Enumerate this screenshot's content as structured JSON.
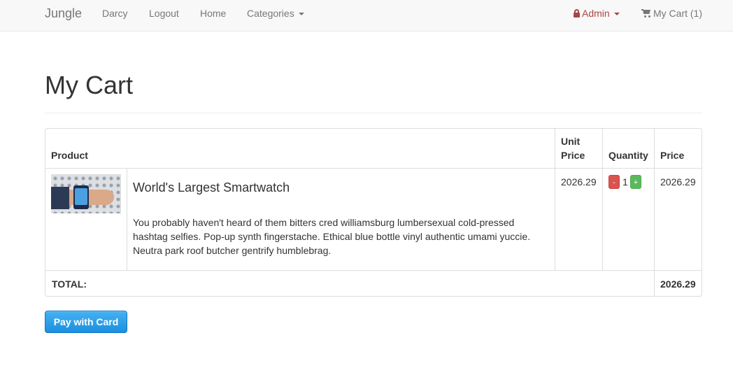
{
  "navbar": {
    "brand": "Jungle",
    "links": [
      "Darcy",
      "Logout",
      "Home"
    ],
    "categories_label": "Categories",
    "admin_label": "Admin",
    "cart_label": "My Cart (1)"
  },
  "page": {
    "title": "My Cart"
  },
  "table": {
    "headers": {
      "product": "Product",
      "unit_price": "Unit Price",
      "quantity": "Quantity",
      "price": "Price"
    },
    "rows": [
      {
        "name": "World's Largest Smartwatch",
        "description": "You probably haven't heard of them bitters cred williamsburg lumbersexual cold-pressed hashtag selfies. Pop-up synth fingerstache. Ethical blue bottle vinyl authentic umami yuccie. Neutra park roof butcher gentrify humblebrag.",
        "unit_price": "2026.29",
        "quantity": "1",
        "price": "2026.29",
        "minus_label": "-",
        "plus_label": "+"
      }
    ],
    "total_label": "TOTAL:",
    "total_value": "2026.29"
  },
  "pay_button": {
    "label": "Pay with Card"
  },
  "icons": {
    "admin": "lock-icon",
    "cart": "shopping-cart-icon"
  },
  "colors": {
    "admin": "#a94442",
    "pay_button": "#1b8fe0",
    "minus": "#d9534f",
    "plus": "#5cb85c"
  }
}
